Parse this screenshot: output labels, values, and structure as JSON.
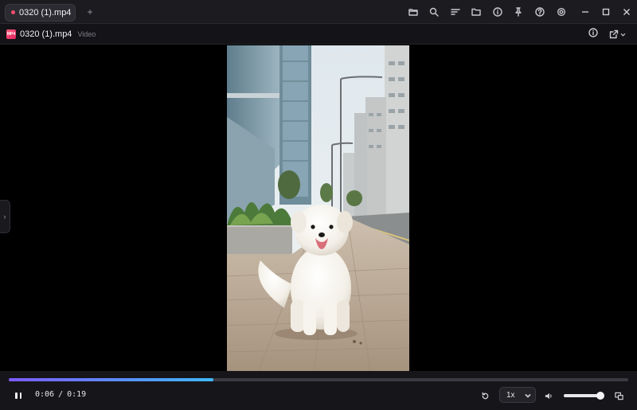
{
  "tabs": [
    {
      "label": "0320 (1).mp4",
      "dot_color": "#ff4d6d"
    }
  ],
  "new_tab_symbol": "+",
  "toolbar_icons": [
    "folder-open-icon",
    "search-icon",
    "sort-lines-icon",
    "folder-icon",
    "info-icon",
    "pin-icon",
    "help-icon",
    "settings-icon"
  ],
  "window_controls": [
    "minimize-icon",
    "maximize-icon",
    "close-icon"
  ],
  "file": {
    "icon_text": "MP4",
    "name": "0320 (1).mp4",
    "type": "Video"
  },
  "file_actions": [
    "info-icon",
    "open-external-icon"
  ],
  "expand_handle": "›",
  "player": {
    "current_time": "0:06",
    "separator": "/",
    "duration": "0:19",
    "progress": 0.33,
    "speed": "1x",
    "volume": 0.95,
    "state": "playing",
    "accent_gradient": [
      "#7d5bff",
      "#3fb8ff"
    ]
  }
}
